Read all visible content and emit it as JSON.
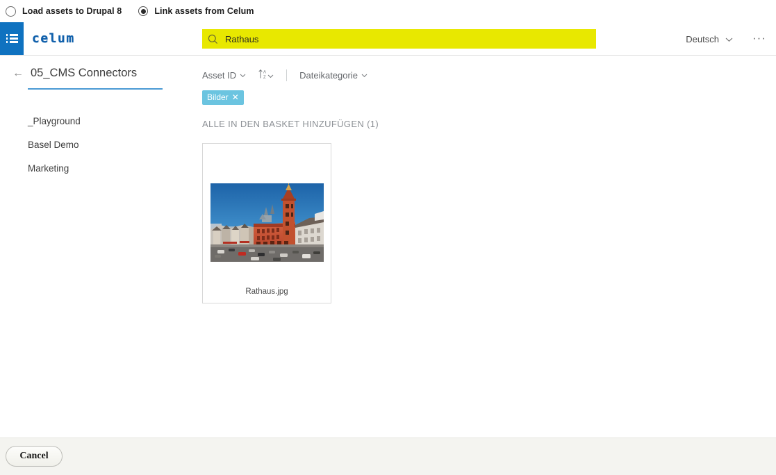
{
  "mode_strip": {
    "options": [
      {
        "label": "Load assets to Drupal 8",
        "selected": false,
        "icon": "radio-unselected-icon"
      },
      {
        "label": "Link assets from Celum",
        "selected": true,
        "icon": "radio-selected-icon"
      }
    ]
  },
  "header": {
    "menu_icon": "hamburger-list-icon",
    "logo_text": "celum",
    "search": {
      "icon": "search-icon",
      "value": "Rathaus",
      "placeholder": "Suche",
      "highlight_color": "#e8e800"
    },
    "language": {
      "label": "Deutsch",
      "caret_icon": "chevron-down-icon"
    },
    "overflow_label": "···"
  },
  "sidebar": {
    "back_icon": "arrow-left-icon",
    "title": "05_CMS Connectors",
    "accent_color": "#4a9ad4",
    "items": [
      {
        "label": "_Playground"
      },
      {
        "label": "Basel Demo"
      },
      {
        "label": "Marketing"
      }
    ]
  },
  "content": {
    "facets": [
      {
        "label": "Asset ID",
        "caret_icon": "chevron-down-icon"
      },
      {
        "label": "Dateikategorie",
        "caret_icon": "chevron-down-icon"
      }
    ],
    "sort": {
      "icon": "sort-az-ascending-icon",
      "caret_icon": "chevron-down-icon"
    },
    "active_filters": [
      {
        "label": "Bilder",
        "remove_icon": "close-icon",
        "color": "#6bc4e0"
      }
    ],
    "basket_action": "ALLE IN DEN BASKET HINZUFÜGEN (1)",
    "assets": [
      {
        "name": "Rathaus.jpg",
        "thumbnail": "basel-rathaus-photo"
      }
    ]
  },
  "footer": {
    "cancel_label": "Cancel"
  }
}
